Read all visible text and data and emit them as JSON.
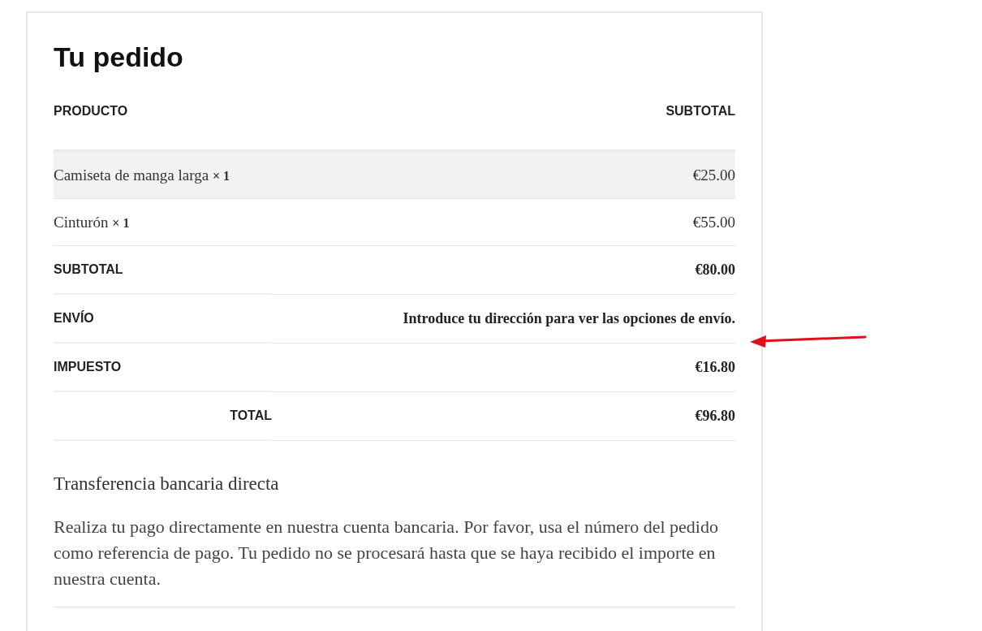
{
  "title": "Tu pedido",
  "table": {
    "columns": [
      "PRODUCTO",
      "SUBTOTAL"
    ],
    "items": [
      {
        "name": "Camiseta de manga larga",
        "quantity": "× 1",
        "subtotal": "€25.00",
        "highlighted": true
      },
      {
        "name": "Cinturón",
        "quantity": "× 1",
        "subtotal": "€55.00",
        "highlighted": false
      }
    ],
    "totals": [
      {
        "kind": "line",
        "label": "SUBTOTAL",
        "value": "€80.00"
      },
      {
        "kind": "line",
        "label": "ENVÍO",
        "value": "Introduce tu dirección para ver las opciones de envío."
      },
      {
        "kind": "line",
        "label": "IMPUESTO",
        "value": "€16.80"
      },
      {
        "kind": "total",
        "label": "TOTAL",
        "value": "€96.80"
      }
    ]
  },
  "payment": {
    "title": "Transferencia bancaria directa",
    "description": "Realiza tu pago directamente en nuestra cuenta bancaria. Por favor, usa el número del pedido como referencia de pago. Tu pedido no se procesará hasta que se haya recibido el importe en nuestra cuenta."
  }
}
